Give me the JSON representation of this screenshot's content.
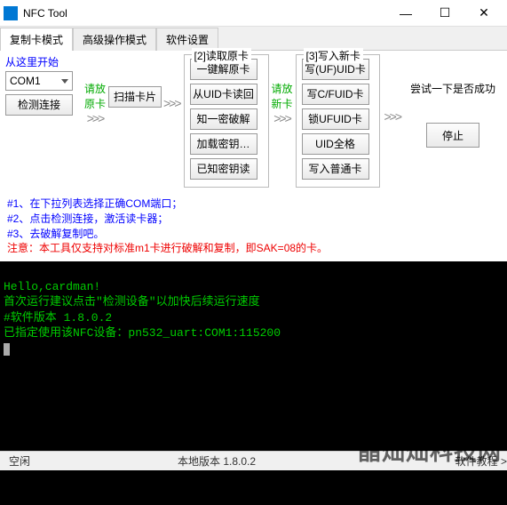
{
  "window": {
    "title": "NFC Tool"
  },
  "win_controls": {
    "min": "—",
    "max": "☐",
    "close": "✕"
  },
  "tabs": {
    "t0": "复制卡模式",
    "t1": "高级操作模式",
    "t2": "软件设置"
  },
  "step1": {
    "title": "从这里开始",
    "port": "COM1",
    "detect": "检测连接"
  },
  "hint_place": {
    "l1": "请放",
    "l2": "原卡"
  },
  "scan_btn": "扫描卡片",
  "group_read": {
    "title": "[2]读取原卡",
    "b0": "一键解原卡",
    "b1": "从UID卡读回",
    "b2": "知一密破解",
    "b3": "加载密钥…",
    "b4": "已知密钥读"
  },
  "hint_new": {
    "l1": "请放",
    "l2": "新卡"
  },
  "group_write": {
    "title": "[3]写入新卡",
    "b0": "写(UF)UID卡",
    "b1": "写C/FUID卡",
    "b2": "锁UFUID卡",
    "b3": "UID全格",
    "b4": "写入普通卡"
  },
  "arrow": ">>>",
  "try_text": "尝试一下是否成功",
  "stop": "停止",
  "notes": {
    "n1": "#1、在下拉列表选择正确COM端口；",
    "n2": "#2、点击检测连接，激活读卡器；",
    "n3": "#3、去破解复制吧。",
    "warn": "注意：本工具仅支持对标准m1卡进行破解和复制，即SAK=08的卡。"
  },
  "console": {
    "l0": "Hello,cardman!",
    "l1": "首次运行建议点击\"检测设备\"以加快后续运行速度",
    "l2": "#软件版本 1.8.0.2",
    "l3": "已指定使用该NFC设备：pn532_uart:COM1:115200"
  },
  "status": {
    "left": "空闲",
    "version": "本地版本 1.8.0.2",
    "tutorial": "软件教程 >"
  },
  "watermark": "晶灿灿科技网"
}
